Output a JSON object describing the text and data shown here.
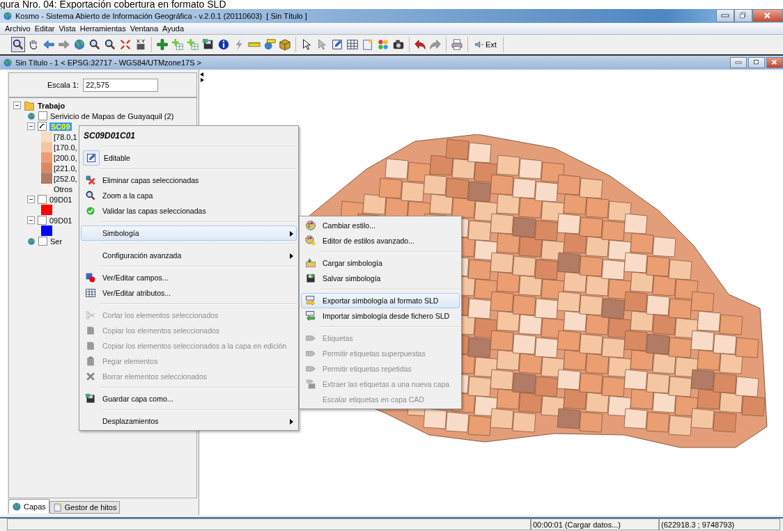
{
  "caption": "gura Nro. 04: Exportación cobertura en formato SLD",
  "window": {
    "title": "Kosmo - Sistema Abierto de Información Geográfica - v.2.0.1 (20110603)  [ Sin Título ]"
  },
  "menubar": [
    "Archivo",
    "Editar",
    "Vista",
    "Herramientas",
    "Ventana",
    "Ayuda"
  ],
  "toolbar": {
    "ext_label": "Ext"
  },
  "frame": {
    "title": "Sin Título - 1 < EPSG:32717 - WGS84/UTMzone17S >"
  },
  "scale": {
    "label": "Escala 1:",
    "value": "22,575"
  },
  "layer_tree": [
    {
      "kind": "folder",
      "label": "Trabajo",
      "expanded": true,
      "children": [
        {
          "kind": "service",
          "label": "Serivicio de Mapas de Guayaquil (2)",
          "checked": false
        },
        {
          "kind": "layer",
          "label": "SC09",
          "checked": true,
          "selected": true,
          "expanded": true,
          "children": [
            {
              "kind": "legend",
              "label": "[78.0,1",
              "color": "#f8dcc8"
            },
            {
              "kind": "legend",
              "label": "[170.0,",
              "color": "#f5c6a2"
            },
            {
              "kind": "legend",
              "label": "[200.0,",
              "color": "#eb9e72"
            },
            {
              "kind": "legend",
              "label": "[221.0,",
              "color": "#da8a62"
            },
            {
              "kind": "legend",
              "label": "[252.0,",
              "color": "#b17b66"
            },
            {
              "kind": "legend",
              "label": "Otros",
              "color": "#f8f3ee"
            }
          ]
        },
        {
          "kind": "layer",
          "label": "09D01",
          "checked": false,
          "selected": false,
          "expanded": true,
          "children": [
            {
              "kind": "legend",
              "color": "#ff0000"
            }
          ]
        },
        {
          "kind": "layer",
          "label": "09D01",
          "checked": false,
          "selected": false,
          "expanded": true,
          "children": [
            {
              "kind": "legend",
              "color": "#0000ff"
            }
          ]
        },
        {
          "kind": "service",
          "label": "Ser",
          "checked": false
        }
      ]
    }
  ],
  "panel_tabs": [
    {
      "label": "Capas",
      "selected": true
    },
    {
      "label": "Gestor de hitos",
      "selected": false
    }
  ],
  "context_menu": {
    "title": "SC09D01C01",
    "groups": [
      [
        {
          "label": "Editable",
          "checked": true,
          "disabled": false,
          "selected": false,
          "submenu": false
        }
      ],
      [
        {
          "label": "Eliminar capas seleccionadas",
          "checked": false,
          "disabled": false,
          "selected": false,
          "submenu": false
        },
        {
          "label": "Zoom a la capa",
          "checked": false,
          "disabled": false,
          "selected": false,
          "submenu": false
        },
        {
          "label": "Validar las capas seleccionadas",
          "checked": false,
          "disabled": false,
          "selected": false,
          "submenu": false
        }
      ],
      [
        {
          "label": "Simbología",
          "checked": false,
          "disabled": false,
          "selected": true,
          "submenu": true
        }
      ],
      [
        {
          "label": "Configuración avanzada",
          "checked": false,
          "disabled": false,
          "selected": false,
          "submenu": true
        }
      ],
      [
        {
          "label": "Ver/Editar campos...",
          "checked": false,
          "disabled": false,
          "selected": false,
          "submenu": false
        },
        {
          "label": "Ver/Editar atributos...",
          "checked": false,
          "disabled": false,
          "selected": false,
          "submenu": false
        }
      ],
      [
        {
          "label": "Cortar los elementos seleccionados",
          "checked": false,
          "disabled": true,
          "selected": false,
          "submenu": false
        },
        {
          "label": "Copiar los elementos seleccionados",
          "checked": false,
          "disabled": true,
          "selected": false,
          "submenu": false
        },
        {
          "label": "Copiar los elementos seleccionados a la capa en edición",
          "checked": false,
          "disabled": true,
          "selected": false,
          "submenu": false
        },
        {
          "label": "Pegar elementos",
          "checked": false,
          "disabled": true,
          "selected": false,
          "submenu": false
        },
        {
          "label": "Borrar elementos seleccionados",
          "checked": false,
          "disabled": true,
          "selected": false,
          "submenu": false
        }
      ],
      [
        {
          "label": "Guardar capa como...",
          "checked": false,
          "disabled": false,
          "selected": false,
          "submenu": false
        }
      ],
      [
        {
          "label": "Desplazamientos",
          "checked": false,
          "disabled": false,
          "selected": false,
          "submenu": true
        }
      ]
    ]
  },
  "submenu": {
    "groups": [
      [
        {
          "label": "Cambiar estilo...",
          "disabled": false,
          "selected": false
        },
        {
          "label": "Editor de estilos avanzado...",
          "disabled": false,
          "selected": false
        }
      ],
      [
        {
          "label": "Cargar simbología",
          "disabled": false,
          "selected": false
        },
        {
          "label": "Salvar simbología",
          "disabled": false,
          "selected": false
        }
      ],
      [
        {
          "label": "Exportar simbología al formato SLD",
          "disabled": false,
          "selected": true
        },
        {
          "label": "Importar simbología desde fichero SLD",
          "disabled": false,
          "selected": false
        }
      ],
      [
        {
          "label": "Etiquetas",
          "disabled": true,
          "selected": false
        },
        {
          "label": "Permitir etiquetas superpuestas",
          "disabled": true,
          "selected": false
        },
        {
          "label": "Permitir etiquetas repetidas",
          "disabled": true,
          "selected": false
        },
        {
          "label": "Extraer las etiquetas a una nueva capa",
          "disabled": true,
          "selected": false
        },
        {
          "label": "Escalar etiquetas en capa CAD",
          "disabled": true,
          "selected": false
        }
      ]
    ]
  },
  "status_bar": {
    "timer": "00:00:01 (Cargar datos...)",
    "coordinates": "(622918.3 ; 9748793)"
  }
}
